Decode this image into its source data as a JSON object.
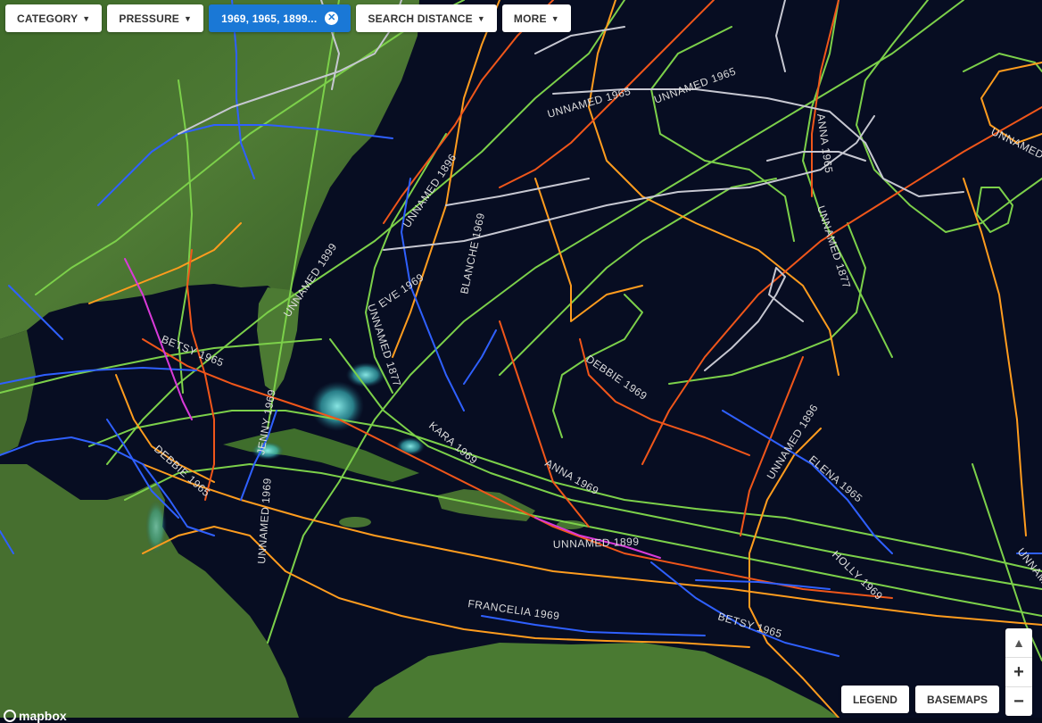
{
  "filters": {
    "category": "CATEGORY",
    "pressure": "PRESSURE",
    "years": "1969, 1965, 1899...",
    "search_distance": "SEARCH DISTANCE",
    "more": "MORE"
  },
  "controls": {
    "legend": "LEGEND",
    "basemaps": "BASEMAPS",
    "zoom_in": "+",
    "zoom_out": "−",
    "compass": "▲"
  },
  "attribution": {
    "logo": "mapbox"
  },
  "colors": {
    "active_filter": "#1a78d6",
    "track_green": "#7cd04a",
    "track_orange": "#ff8a1e",
    "track_red": "#f0561a",
    "track_blue": "#2a5dff",
    "track_gray": "#c8c8d0",
    "track_magenta": "#d93ad9"
  },
  "storm_labels": [
    "UNNAMED 1965",
    "UNNAMED 1965",
    "ANNA 1965",
    "UNNAMED 1877",
    "UNNAMED 1896",
    "BLANCHE 1969",
    "UNNAMED 1899",
    "EVE 1969",
    "UNNAMED 1877",
    "BETSY 1965",
    "DEBBIE 1969",
    "KARA 1969",
    "ANNA 1969",
    "JENNY 1969",
    "DEBBIE 1965",
    "UNNAMED 1969",
    "UNNAMED 1899",
    "FRANCELIA 1969",
    "BETSY 1965",
    "HOLLY 1969",
    "ELENA 1965",
    "UNNAMED 1896",
    "UNNAMED",
    "UNNAMED"
  ]
}
